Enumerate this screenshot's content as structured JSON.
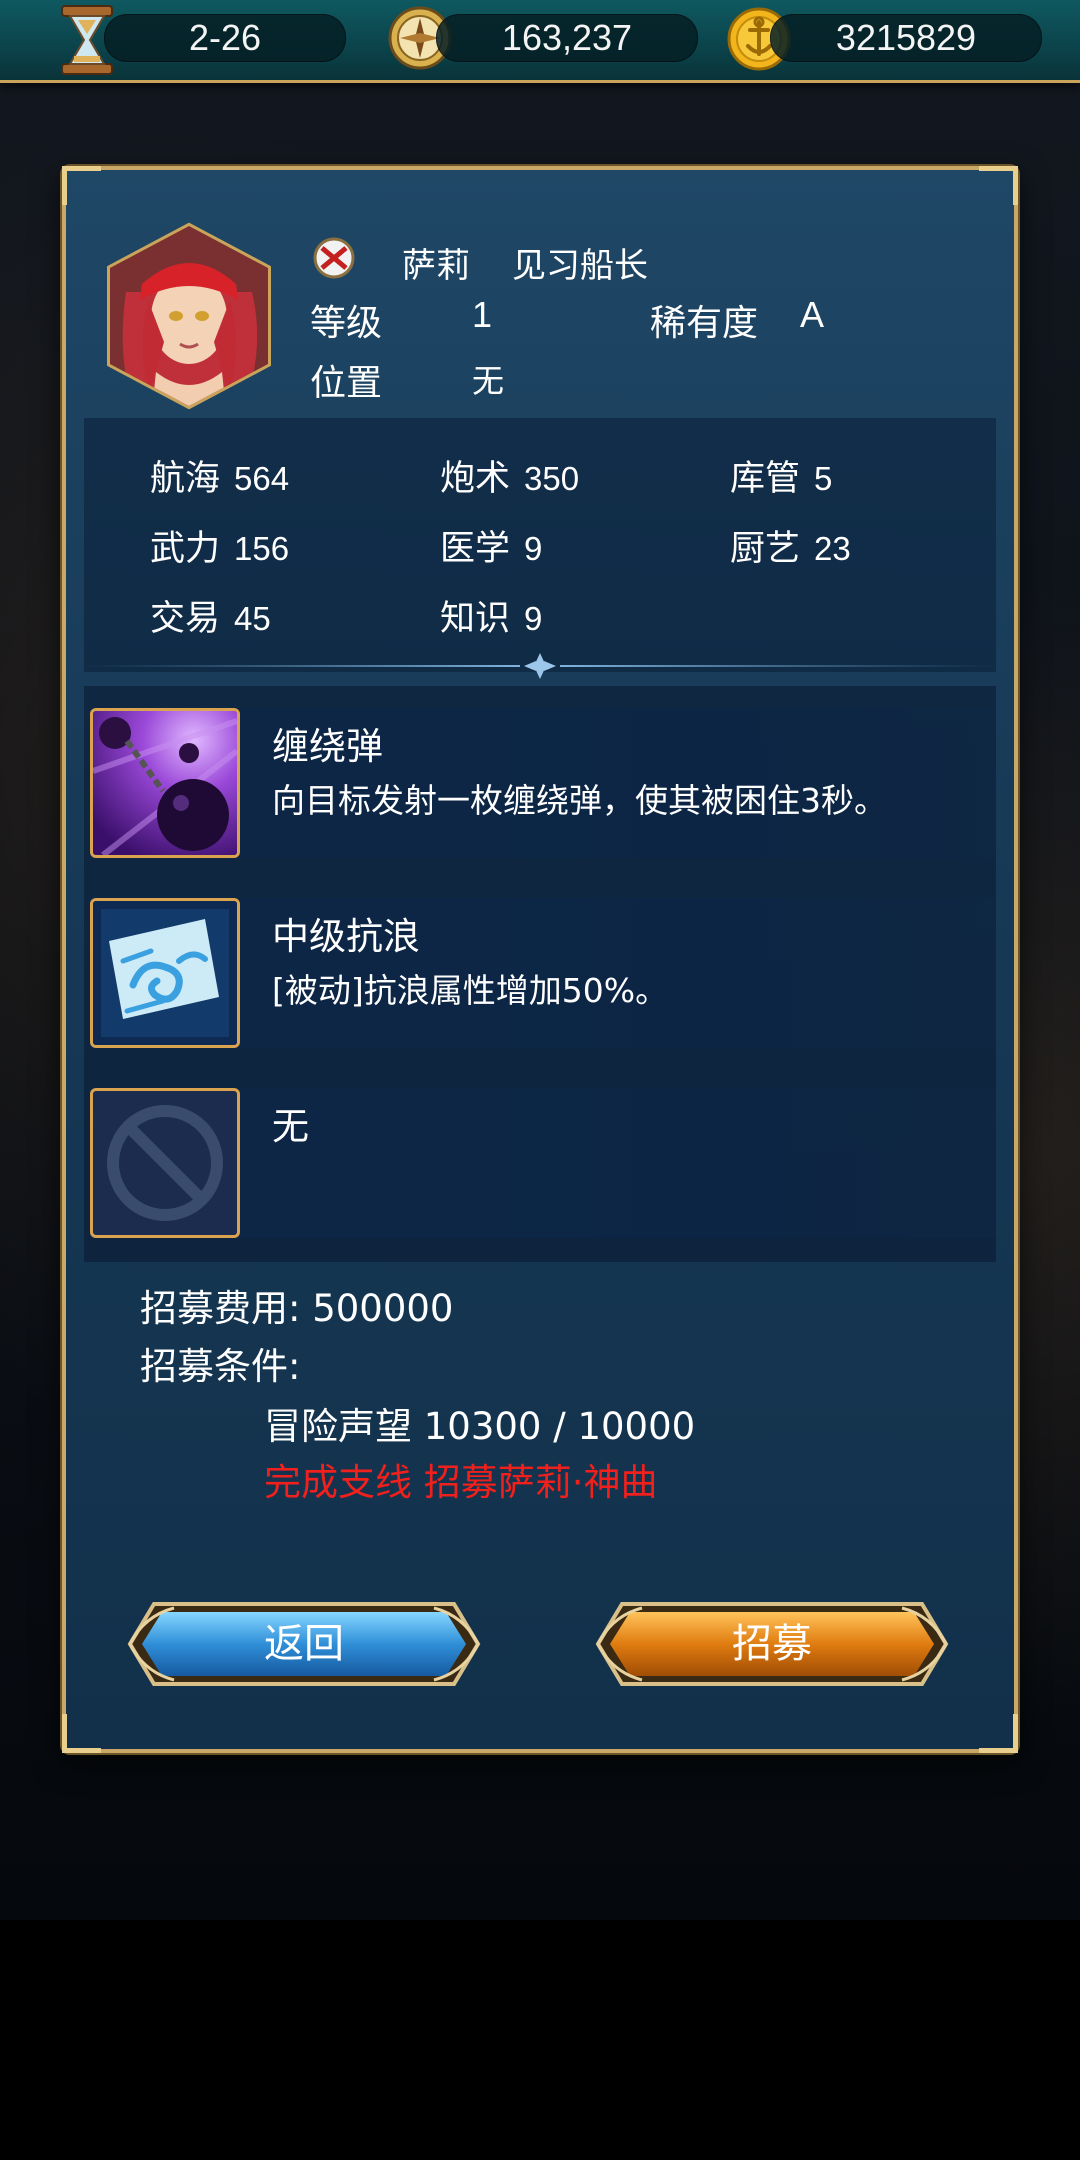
{
  "resources": {
    "stage": "2-26",
    "reputation": "163,237",
    "gold": "3215829"
  },
  "character": {
    "name": "萨莉",
    "title": "见习船长",
    "level_label": "等级",
    "level": "1",
    "rarity_label": "稀有度",
    "rarity": "A",
    "position_label": "位置",
    "position": "无"
  },
  "stats": [
    {
      "label": "航海",
      "value": "564"
    },
    {
      "label": "炮术",
      "value": "350"
    },
    {
      "label": "库管",
      "value": "5"
    },
    {
      "label": "武力",
      "value": "156"
    },
    {
      "label": "医学",
      "value": "9"
    },
    {
      "label": "厨艺",
      "value": "23"
    },
    {
      "label": "交易",
      "value": "45"
    },
    {
      "label": "知识",
      "value": "9"
    }
  ],
  "skills": [
    {
      "name": "缠绕弹",
      "desc": "向目标发射一枚缠绕弹，使其被困住3秒。",
      "icon": "chain-shot-icon"
    },
    {
      "name": "中级抗浪",
      "desc": "[被动]抗浪属性增加50%。",
      "icon": "wave-resist-icon"
    },
    {
      "name": "无",
      "desc": "",
      "icon": "empty-slot-icon"
    }
  ],
  "recruit": {
    "cost_label": "招募费用: 500000",
    "conditions_label": "招募条件:",
    "condition_1": "冒险声望 10300 / 10000",
    "condition_2": "完成支线 招募萨莉·神曲"
  },
  "buttons": {
    "back": "返回",
    "recruit": "招募"
  },
  "colors": {
    "panel_bg": "#1a3d5c",
    "gold_border": "#c9a868",
    "requirement_unmet": "#f0201c",
    "back_button": "#2f8fd8",
    "recruit_button": "#e07c10"
  }
}
